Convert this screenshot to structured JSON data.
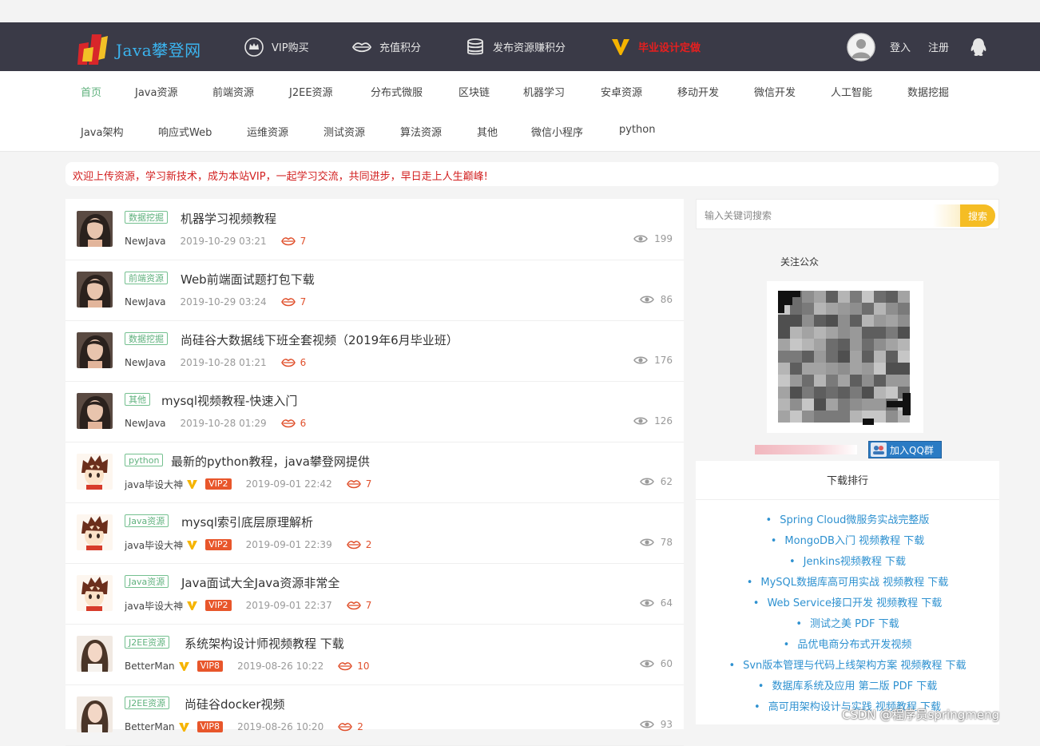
{
  "header": {
    "logo_text": "Java攀登网",
    "nav": [
      {
        "label": "VIP购买",
        "icon": "crown-icon"
      },
      {
        "label": "充值积分",
        "icon": "lips-icon"
      },
      {
        "label": "发布资源赚积分",
        "icon": "database-icon"
      },
      {
        "label": "毕业设计定做",
        "icon": "v-badge-icon"
      }
    ],
    "login": "登入",
    "register": "注册"
  },
  "categories": {
    "row1": [
      "首页",
      "Java资源",
      "前端资源",
      "J2EE资源",
      "分布式微服",
      "区块链",
      "机器学习",
      "安卓资源",
      "移动开发",
      "微信开发",
      "人工智能",
      "数据挖掘"
    ],
    "row2": [
      "Java架构",
      "响应式Web",
      "运维资源",
      "测试资源",
      "算法资源",
      "其他",
      "微信小程序",
      "python"
    ],
    "active": "首页"
  },
  "notice": "欢迎上传资源，学习新技术，成为本站VIP，一起学习交流，共同进步，早日走上人生巅峰!",
  "posts": [
    {
      "tag": "数据挖掘",
      "title": "机器学习视频教程",
      "author": "NewJava",
      "vip": "",
      "verified": false,
      "date": "2019-10-29 03:21",
      "likes": "7",
      "views": "199",
      "avatar": "girl-dark"
    },
    {
      "tag": "前端资源",
      "title": "Web前端面试题打包下载",
      "author": "NewJava",
      "vip": "",
      "verified": false,
      "date": "2019-10-29 03:24",
      "likes": "7",
      "views": "86",
      "avatar": "girl-dark"
    },
    {
      "tag": "数据挖掘",
      "title": "尚硅谷大数据线下班全套视频（2019年6月毕业班）",
      "author": "NewJava",
      "vip": "",
      "verified": false,
      "date": "2019-10-28 01:21",
      "likes": "6",
      "views": "176",
      "avatar": "girl-dark"
    },
    {
      "tag": "其他",
      "title": "mysql视频教程-快速入门",
      "author": "NewJava",
      "vip": "",
      "verified": false,
      "date": "2019-10-28 01:29",
      "likes": "6",
      "views": "126",
      "avatar": "girl-dark"
    },
    {
      "tag": "python",
      "title": "最新的python教程，java攀登网提供",
      "author": "java毕设大神",
      "vip": "VIP2",
      "verified": true,
      "date": "2019-09-01 22:42",
      "likes": "7",
      "views": "62",
      "avatar": "anime-boy"
    },
    {
      "tag": "Java资源",
      "title": "mysql索引底层原理解析",
      "author": "java毕设大神",
      "vip": "VIP2",
      "verified": true,
      "date": "2019-09-01 22:39",
      "likes": "2",
      "views": "78",
      "avatar": "anime-boy"
    },
    {
      "tag": "Java资源",
      "title": "Java面试大全Java资源非常全",
      "author": "java毕设大神",
      "vip": "VIP2",
      "verified": true,
      "date": "2019-09-01 22:37",
      "likes": "7",
      "views": "64",
      "avatar": "anime-boy"
    },
    {
      "tag": "J2EE资源",
      "title": "系统架构设计师视频教程 下载",
      "author": "BetterMan",
      "vip": "VIP8",
      "verified": true,
      "date": "2019-08-26 10:22",
      "likes": "10",
      "views": "60",
      "avatar": "girl-light"
    },
    {
      "tag": "J2EE资源",
      "title": "尚硅谷docker视频",
      "author": "BetterMan",
      "vip": "VIP8",
      "verified": true,
      "date": "2019-08-26 10:20",
      "likes": "2",
      "views": "93",
      "avatar": "girl-light"
    }
  ],
  "sidebar": {
    "search_placeholder": "输入关键词搜索",
    "search_button": "搜索",
    "follow_title": "关注公众",
    "qq_group_label": "加入QQ群",
    "rank_title": "下载排行",
    "rank": [
      "Spring Cloud微服务实战完整版",
      "MongoDB入门 视频教程 下载",
      "Jenkins视频教程 下载",
      "MySQL数据库高可用实战 视频教程 下载",
      "Web Service接口开发 视频教程 下载",
      "测试之美 PDF 下载",
      "品优电商分布式开发视频",
      "Svn版本管理与代码上线架构方案 视频教程 下载",
      "数据库系统及应用 第二版 PDF 下载",
      "高可用架构设计与实践 视频教程 下载"
    ]
  },
  "watermark": "CSDN @程序员springmeng",
  "colors": {
    "header_bg": "#3a3a47",
    "accent_green": "#5fb17d",
    "like_red": "#e0512d",
    "vip_bg": "#e8562b",
    "link_blue": "#2e91d0",
    "search_yellow": "#f5bd24"
  }
}
